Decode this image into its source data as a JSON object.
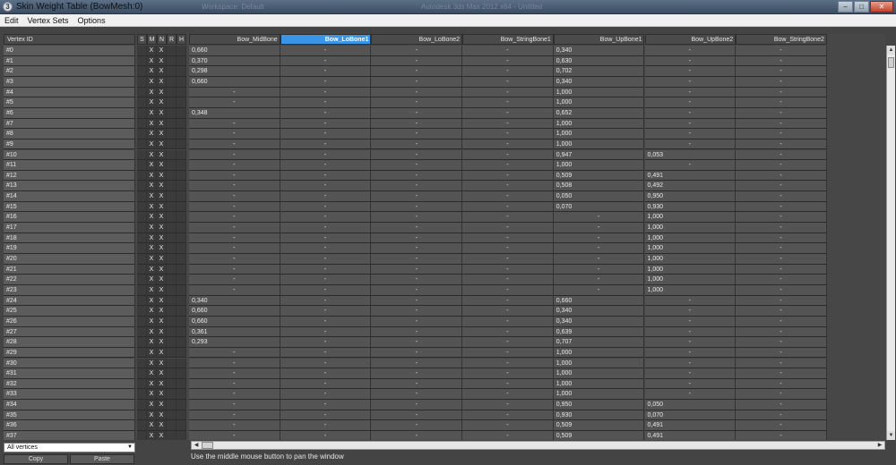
{
  "window": {
    "title": "Skin Weight Table (BowMesh:0)",
    "icon": "3ds-max-icon"
  },
  "background_titles": [
    "Workspace: Default",
    "Autodesk 3ds Max 2012 x64 - Untitled"
  ],
  "menu": [
    {
      "label": "Edit"
    },
    {
      "label": "Vertex Sets"
    },
    {
      "label": "Options"
    }
  ],
  "columns": {
    "vertex_id": "Vertex ID",
    "flags": [
      "S",
      "M",
      "N",
      "R",
      "H"
    ],
    "bones": [
      "Bow_MidBone",
      "Bow_LoBone1",
      "Bow_LoBone2",
      "Bow_StringBone1",
      "Bow_UpBone1",
      "Bow_UpBone2",
      "Bow_StringBone2"
    ],
    "selected_bone_index": 1
  },
  "rows": [
    {
      "id": "#0",
      "flags": [
        "",
        "X",
        "X",
        "",
        ""
      ],
      "weights": [
        "0,660",
        "-",
        "-",
        "-",
        "0,340",
        "-",
        "-"
      ]
    },
    {
      "id": "#1",
      "flags": [
        "",
        "X",
        "X",
        "",
        ""
      ],
      "weights": [
        "0,370",
        "-",
        "-",
        "-",
        "0,630",
        "-",
        "-"
      ]
    },
    {
      "id": "#2",
      "flags": [
        "",
        "X",
        "X",
        "",
        ""
      ],
      "weights": [
        "0,298",
        "-",
        "-",
        "-",
        "0,702",
        "-",
        "-"
      ]
    },
    {
      "id": "#3",
      "flags": [
        "",
        "X",
        "X",
        "",
        ""
      ],
      "weights": [
        "0,660",
        "-",
        "-",
        "-",
        "0,340",
        "-",
        "-"
      ]
    },
    {
      "id": "#4",
      "flags": [
        "",
        "X",
        "X",
        "",
        ""
      ],
      "weights": [
        "-",
        "-",
        "-",
        "-",
        "1,000",
        "-",
        "-"
      ]
    },
    {
      "id": "#5",
      "flags": [
        "",
        "X",
        "X",
        "",
        ""
      ],
      "weights": [
        "-",
        "-",
        "-",
        "-",
        "1,000",
        "-",
        "-"
      ]
    },
    {
      "id": "#6",
      "flags": [
        "",
        "X",
        "X",
        "",
        ""
      ],
      "weights": [
        "0,348",
        "-",
        "-",
        "-",
        "0,652",
        "-",
        "-"
      ]
    },
    {
      "id": "#7",
      "flags": [
        "",
        "X",
        "X",
        "",
        ""
      ],
      "weights": [
        "-",
        "-",
        "-",
        "-",
        "1,000",
        "-",
        "-"
      ]
    },
    {
      "id": "#8",
      "flags": [
        "",
        "X",
        "X",
        "",
        ""
      ],
      "weights": [
        "-",
        "-",
        "-",
        "-",
        "1,000",
        "-",
        "-"
      ]
    },
    {
      "id": "#9",
      "flags": [
        "",
        "X",
        "X",
        "",
        ""
      ],
      "weights": [
        "-",
        "-",
        "-",
        "-",
        "1,000",
        "-",
        "-"
      ]
    },
    {
      "id": "#10",
      "flags": [
        "",
        "X",
        "X",
        "",
        ""
      ],
      "weights": [
        "-",
        "-",
        "-",
        "-",
        "0,947",
        "0,053",
        "-"
      ]
    },
    {
      "id": "#11",
      "flags": [
        "",
        "X",
        "X",
        "",
        ""
      ],
      "weights": [
        "-",
        "-",
        "-",
        "-",
        "1,000",
        "-",
        "-"
      ]
    },
    {
      "id": "#12",
      "flags": [
        "",
        "X",
        "X",
        "",
        ""
      ],
      "weights": [
        "-",
        "-",
        "-",
        "-",
        "0,509",
        "0,491",
        "-"
      ]
    },
    {
      "id": "#13",
      "flags": [
        "",
        "X",
        "X",
        "",
        ""
      ],
      "weights": [
        "-",
        "-",
        "-",
        "-",
        "0,508",
        "0,492",
        "-"
      ]
    },
    {
      "id": "#14",
      "flags": [
        "",
        "X",
        "X",
        "",
        ""
      ],
      "weights": [
        "-",
        "-",
        "-",
        "-",
        "0,050",
        "0,950",
        "-"
      ]
    },
    {
      "id": "#15",
      "flags": [
        "",
        "X",
        "X",
        "",
        ""
      ],
      "weights": [
        "-",
        "-",
        "-",
        "-",
        "0,070",
        "0,930",
        "-"
      ]
    },
    {
      "id": "#16",
      "flags": [
        "",
        "X",
        "X",
        "",
        ""
      ],
      "weights": [
        "-",
        "-",
        "-",
        "-",
        "-",
        "1,000",
        "-"
      ]
    },
    {
      "id": "#17",
      "flags": [
        "",
        "X",
        "X",
        "",
        ""
      ],
      "weights": [
        "-",
        "-",
        "-",
        "-",
        "-",
        "1,000",
        "-"
      ]
    },
    {
      "id": "#18",
      "flags": [
        "",
        "X",
        "X",
        "",
        ""
      ],
      "weights": [
        "-",
        "-",
        "-",
        "-",
        "-",
        "1,000",
        "-"
      ]
    },
    {
      "id": "#19",
      "flags": [
        "",
        "X",
        "X",
        "",
        ""
      ],
      "weights": [
        "-",
        "-",
        "-",
        "-",
        "-",
        "1,000",
        "-"
      ]
    },
    {
      "id": "#20",
      "flags": [
        "",
        "X",
        "X",
        "",
        ""
      ],
      "weights": [
        "-",
        "-",
        "-",
        "-",
        "-",
        "1,000",
        "-"
      ]
    },
    {
      "id": "#21",
      "flags": [
        "",
        "X",
        "X",
        "",
        ""
      ],
      "weights": [
        "-",
        "-",
        "-",
        "-",
        "-",
        "1,000",
        "-"
      ]
    },
    {
      "id": "#22",
      "flags": [
        "",
        "X",
        "X",
        "",
        ""
      ],
      "weights": [
        "-",
        "-",
        "-",
        "-",
        "-",
        "1,000",
        "-"
      ]
    },
    {
      "id": "#23",
      "flags": [
        "",
        "X",
        "X",
        "",
        ""
      ],
      "weights": [
        "-",
        "-",
        "-",
        "-",
        "-",
        "1,000",
        "-"
      ]
    },
    {
      "id": "#24",
      "flags": [
        "",
        "X",
        "X",
        "",
        ""
      ],
      "weights": [
        "0,340",
        "-",
        "-",
        "-",
        "0,660",
        "-",
        "-"
      ]
    },
    {
      "id": "#25",
      "flags": [
        "",
        "X",
        "X",
        "",
        ""
      ],
      "weights": [
        "0,660",
        "-",
        "-",
        "-",
        "0,340",
        "-",
        "-"
      ]
    },
    {
      "id": "#26",
      "flags": [
        "",
        "X",
        "X",
        "",
        ""
      ],
      "weights": [
        "0,660",
        "-",
        "-",
        "-",
        "0,340",
        "-",
        "-"
      ]
    },
    {
      "id": "#27",
      "flags": [
        "",
        "X",
        "X",
        "",
        ""
      ],
      "weights": [
        "0,361",
        "-",
        "-",
        "-",
        "0,639",
        "-",
        "-"
      ]
    },
    {
      "id": "#28",
      "flags": [
        "",
        "X",
        "X",
        "",
        ""
      ],
      "weights": [
        "0,293",
        "-",
        "-",
        "-",
        "0,707",
        "-",
        "-"
      ]
    },
    {
      "id": "#29",
      "flags": [
        "",
        "X",
        "X",
        "",
        ""
      ],
      "weights": [
        "-",
        "-",
        "-",
        "-",
        "1,000",
        "-",
        "-"
      ]
    },
    {
      "id": "#30",
      "flags": [
        "",
        "X",
        "X",
        "",
        ""
      ],
      "weights": [
        "-",
        "-",
        "-",
        "-",
        "1,000",
        "-",
        "-"
      ]
    },
    {
      "id": "#31",
      "flags": [
        "",
        "X",
        "X",
        "",
        ""
      ],
      "weights": [
        "-",
        "-",
        "-",
        "-",
        "1,000",
        "-",
        "-"
      ]
    },
    {
      "id": "#32",
      "flags": [
        "",
        "X",
        "X",
        "",
        ""
      ],
      "weights": [
        "-",
        "-",
        "-",
        "-",
        "1,000",
        "-",
        "-"
      ]
    },
    {
      "id": "#33",
      "flags": [
        "",
        "X",
        "X",
        "",
        ""
      ],
      "weights": [
        "-",
        "-",
        "-",
        "-",
        "1,000",
        "-",
        "-"
      ]
    },
    {
      "id": "#34",
      "flags": [
        "",
        "X",
        "X",
        "",
        ""
      ],
      "weights": [
        "-",
        "-",
        "-",
        "-",
        "0,950",
        "0,050",
        "-"
      ]
    },
    {
      "id": "#35",
      "flags": [
        "",
        "X",
        "X",
        "",
        ""
      ],
      "weights": [
        "-",
        "-",
        "-",
        "-",
        "0,930",
        "0,070",
        "-"
      ]
    },
    {
      "id": "#36",
      "flags": [
        "",
        "X",
        "X",
        "",
        ""
      ],
      "weights": [
        "-",
        "-",
        "-",
        "-",
        "0,509",
        "0,491",
        "-"
      ]
    },
    {
      "id": "#37",
      "flags": [
        "",
        "X",
        "X",
        "",
        ""
      ],
      "weights": [
        "-",
        "-",
        "-",
        "-",
        "0,509",
        "0,491",
        "-"
      ]
    }
  ],
  "vertex_filter": {
    "selected": "All vertices"
  },
  "buttons": {
    "copy": "Copy",
    "paste": "Paste"
  },
  "status_text": "Use the middle mouse button to pan the window",
  "colors": {
    "selected_header": "#3a95e6",
    "title_bar": "#4b5d73",
    "cell_bg": "#545454"
  }
}
